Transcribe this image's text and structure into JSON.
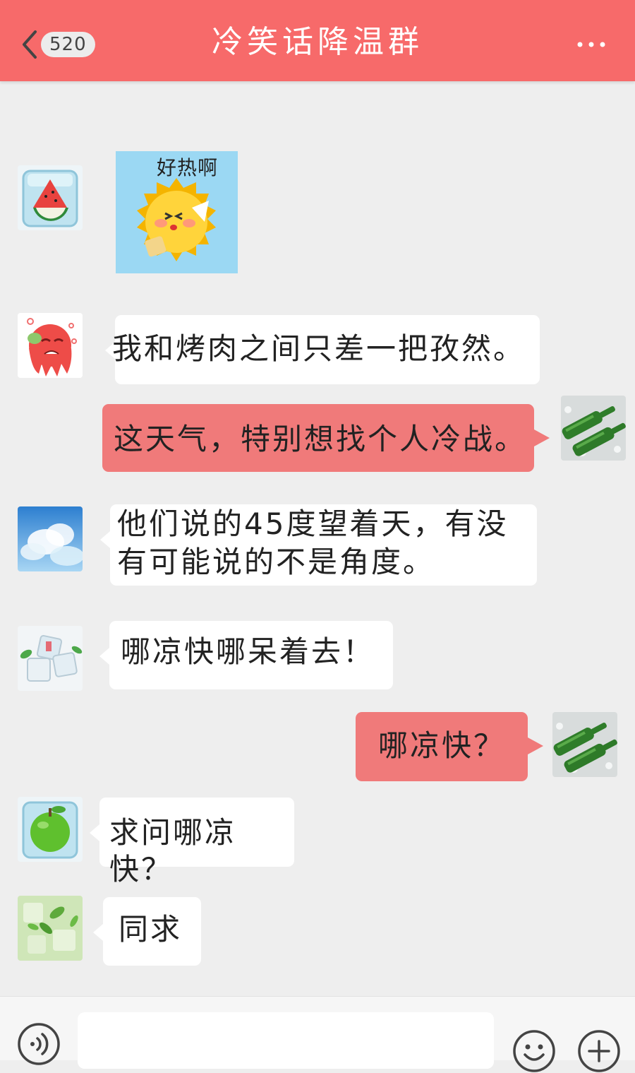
{
  "header": {
    "back_badge": "520",
    "title": "冷笑话降温群"
  },
  "messages": [
    {
      "side": "in",
      "type": "sticker",
      "avatar": "watermelon-ice-cube",
      "caption": "好热啊",
      "sticker_icon": "sweating-sun-sticker"
    },
    {
      "side": "in",
      "type": "text",
      "avatar": "melting-watermelon",
      "text": "我和烤肉之间只差一把孜然。"
    },
    {
      "side": "out",
      "type": "text",
      "avatar": "green-bottles-on-ice",
      "text": "这天气，特别想找个人冷战。"
    },
    {
      "side": "in",
      "type": "text",
      "avatar": "sky-clouds",
      "line1": "他们说的45度望着天，有没",
      "line2": "有可能说的不是角度。"
    },
    {
      "side": "in",
      "type": "text",
      "avatar": "ice-cubes-mint",
      "text": "哪凉快哪呆着去！"
    },
    {
      "side": "out",
      "type": "text",
      "avatar": "green-bottles-on-ice",
      "text": "哪凉快？"
    },
    {
      "side": "in",
      "type": "text",
      "avatar": "apple-ice-cube",
      "text": "求问哪凉快？"
    },
    {
      "side": "in",
      "type": "text",
      "avatar": "mint-ice",
      "text": "同求"
    }
  ],
  "input": {
    "placeholder": ""
  },
  "colors": {
    "header": "#f76a6a",
    "outgoing_bubble": "#f07a7a",
    "incoming_bubble": "#ffffff",
    "background": "#eeeeee"
  }
}
